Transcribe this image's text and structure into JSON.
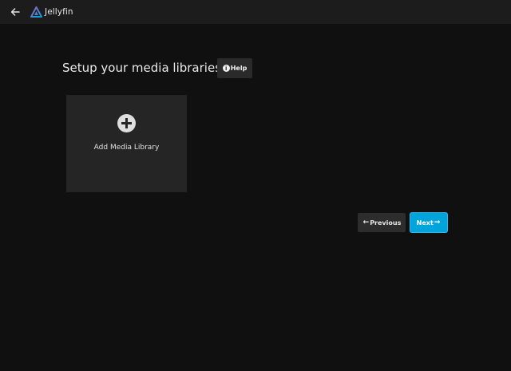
{
  "header": {
    "app_name": "Jellyfin",
    "back_icon": "arrow-left-icon",
    "logo_icon": "jellyfin-logo-icon"
  },
  "main": {
    "title": "Setup your media libraries",
    "help_label": "Help",
    "help_icon": "info-icon",
    "library_card": {
      "label": "Add Media Library",
      "icon": "plus-circle-icon"
    }
  },
  "nav": {
    "previous_label": "Previous",
    "next_label": "Next",
    "previous_arrow": "←",
    "next_arrow": "→"
  },
  "colors": {
    "background": "#101010",
    "header": "#1c1c1c",
    "card": "#252525",
    "accent": "#00a4dc"
  }
}
